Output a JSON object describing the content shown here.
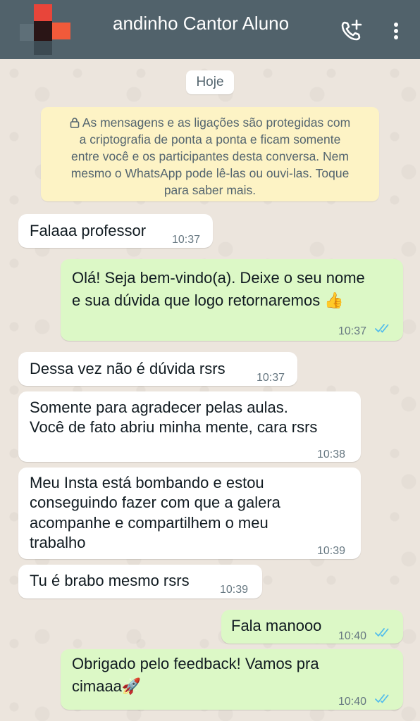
{
  "header": {
    "title": "andinho Cantor Aluno",
    "icons": [
      "add-call-icon",
      "more-vert-icon"
    ]
  },
  "date_chip": "Hoje",
  "notice": {
    "icon": "lock-icon",
    "lines": [
      "As mensagens e as ligações são protegidas com",
      "a criptografia de ponta a ponta e ficam somente",
      "entre você e os participantes desta conversa. Nem",
      "mesmo o WhatsApp pode lê-las ou ouvi-las. Toque",
      "para saber mais."
    ]
  },
  "messages": [
    {
      "dir": "in",
      "lines": [
        "Falaaa professor"
      ],
      "time": "10:37"
    },
    {
      "dir": "out",
      "lines": [
        "Olá! Seja bem-vindo(a). Deixe o seu nome",
        "e sua dúvida que logo retornaremos 👍"
      ],
      "time": "10:37",
      "status": "read"
    },
    {
      "dir": "in",
      "lines": [
        "Dessa vez não é dúvida rsrs"
      ],
      "time": "10:37"
    },
    {
      "dir": "in",
      "lines": [
        "Somente para agradecer pelas aulas.",
        "Você de fato abriu minha mente, cara rsrs"
      ],
      "time": "10:38"
    },
    {
      "dir": "in",
      "lines": [
        "Meu Insta está bombando e estou",
        "conseguindo fazer com que a galera",
        "acompanhe e compartilhem o meu",
        "trabalho"
      ],
      "time": "10:39"
    },
    {
      "dir": "in",
      "lines": [
        "Tu é brabo mesmo rsrs"
      ],
      "time": "10:39"
    },
    {
      "dir": "out",
      "lines": [
        "Fala manooo"
      ],
      "time": "10:40",
      "status": "read"
    },
    {
      "dir": "out",
      "lines": [
        "Obrigado pelo feedback! Vamos pra",
        "cimaaa🚀"
      ],
      "time": "10:40",
      "status": "read"
    }
  ],
  "colors": {
    "header": "#51626b",
    "chat_bg": "#ece5dd",
    "incoming": "#ffffff",
    "outgoing": "#dcf8c6",
    "notice": "#fdf3c5",
    "read_ticks": "#53bdeb"
  }
}
